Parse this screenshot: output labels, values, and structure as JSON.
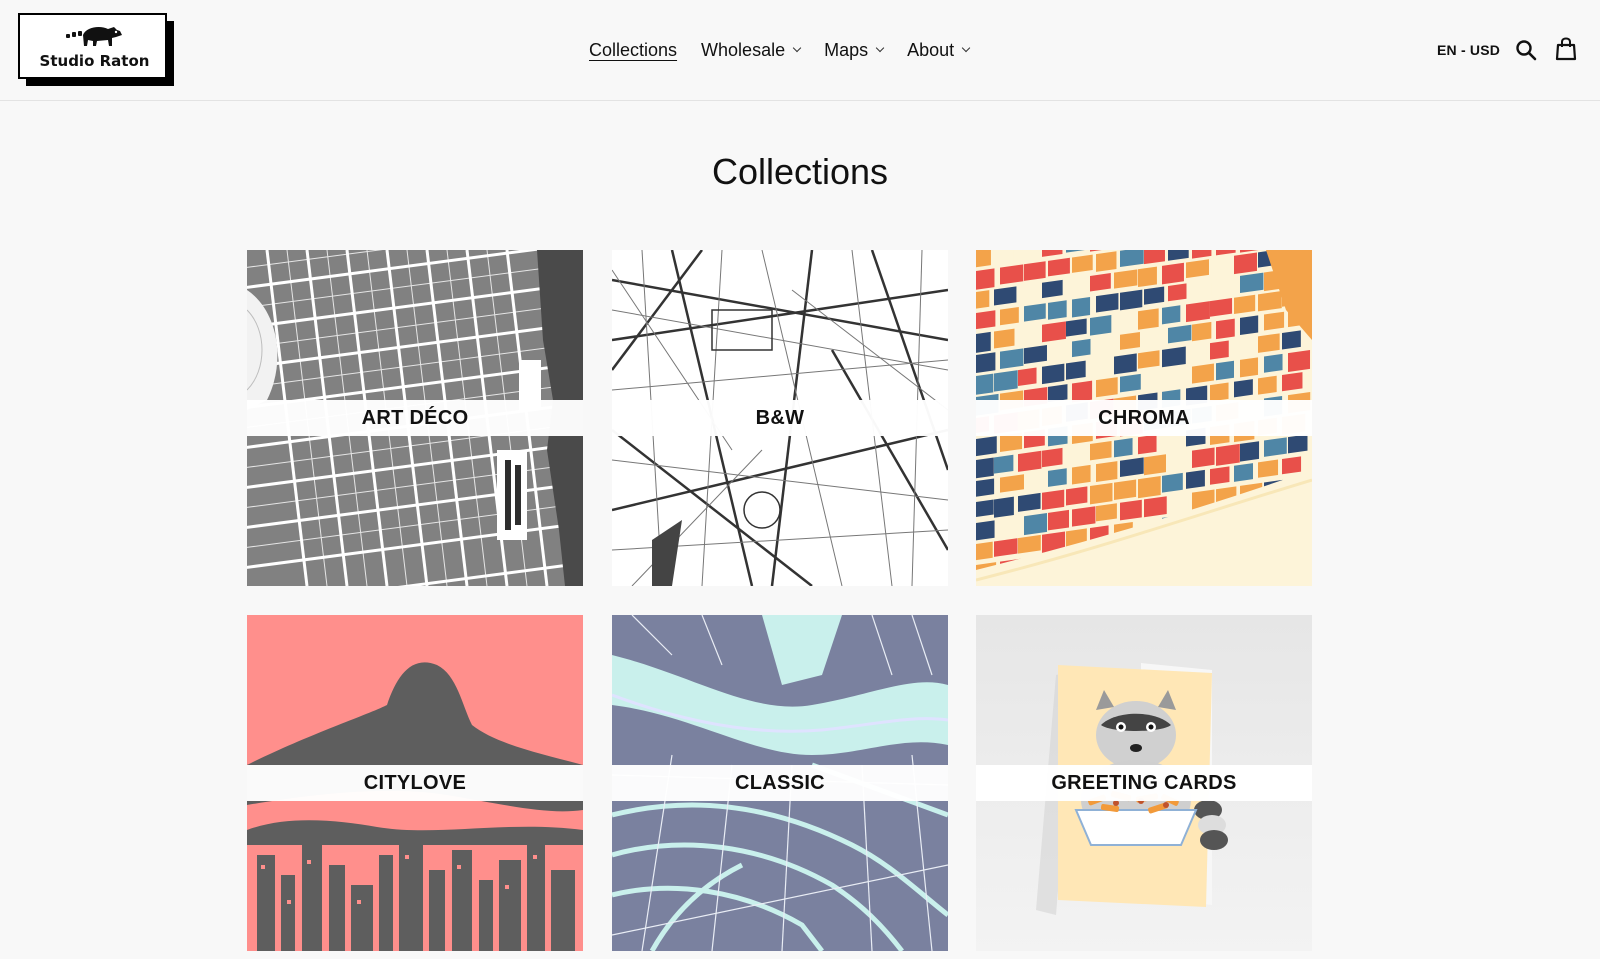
{
  "header": {
    "logo_text": "Studio Raton",
    "nav": [
      {
        "label": "Collections"
      },
      {
        "label": "Wholesale"
      },
      {
        "label": "Maps"
      },
      {
        "label": "About"
      }
    ],
    "locale": "EN - USD",
    "icons": {
      "search": "search-icon",
      "cart": "cart-icon",
      "logo": "raccoon-logo-icon"
    }
  },
  "main": {
    "title": "Collections",
    "collections": [
      {
        "label": "ART DÉCO",
        "color": "#4a4a4a"
      },
      {
        "label": "B&W",
        "color": "#ffffff"
      },
      {
        "label": "CHROMA",
        "color": "#f3a34a"
      },
      {
        "label": "CITYLOVE",
        "color": "#ff8f8c"
      },
      {
        "label": "CLASSIC",
        "color": "#7a819f"
      },
      {
        "label": "GREETING CARDS",
        "color": "#ffe7b6"
      }
    ]
  }
}
